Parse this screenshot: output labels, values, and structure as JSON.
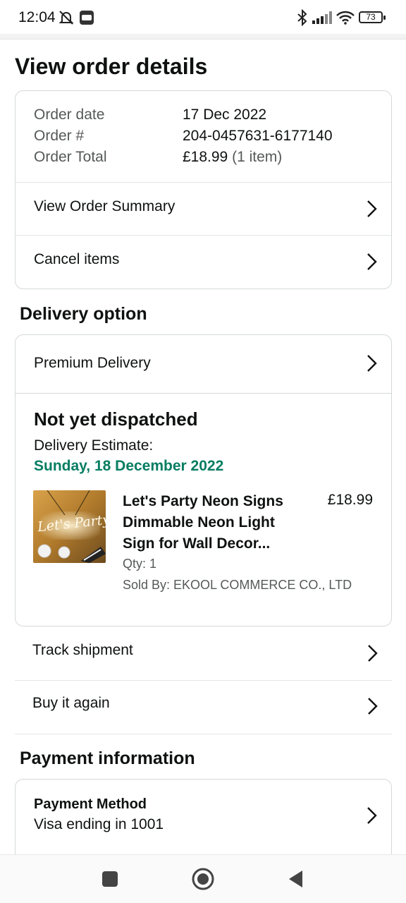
{
  "status_bar": {
    "time": "12:04",
    "battery": "73"
  },
  "page": {
    "title": "View order details"
  },
  "order_summary": {
    "rows": [
      {
        "label": "Order date",
        "value": "17 Dec 2022"
      },
      {
        "label": "Order #",
        "value": "204-0457631-6177140"
      },
      {
        "label": "Order Total",
        "value": "£18.99",
        "note": "(1 item)"
      }
    ],
    "view_summary_label": "View Order Summary",
    "cancel_items_label": "Cancel items"
  },
  "delivery": {
    "section_title": "Delivery option",
    "option_label": "Premium Delivery",
    "status": "Not yet dispatched",
    "estimate_label": "Delivery Estimate:",
    "estimate_date": "Sunday, 18 December 2022",
    "product": {
      "title": "Let's Party Neon Signs Dimmable Neon Light Sign for Wall Decor...",
      "price": "£18.99",
      "qty": "Qty: 1",
      "sold_by": "Sold By: EKOOL COMMERCE CO., LTD",
      "thumb_text": "Let's Party"
    },
    "track_label": "Track shipment",
    "buy_again_label": "Buy it again"
  },
  "payment": {
    "section_title": "Payment information",
    "method_title": "Payment Method",
    "method_value": "Visa ending in 1001"
  },
  "colors": {
    "text": "#0f1111",
    "muted": "#565959",
    "delivery_green": "#067d62",
    "border": "#d5d9d9"
  }
}
